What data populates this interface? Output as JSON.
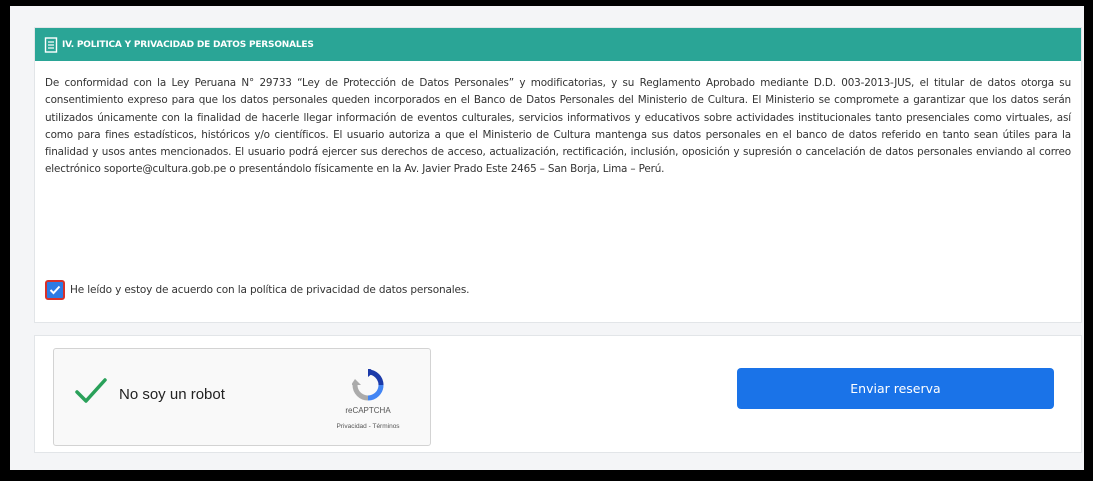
{
  "privacy": {
    "header_icon": "document-icon",
    "title": "IV. POLITICA Y PRIVACIDAD DE DATOS PERSONALES",
    "policy_text": "De conformidad con la Ley Peruana N° 29733 “Ley de Protección de Datos Personales” y modificatorias, y su Reglamento Aprobado mediante D.D. 003-2013-JUS, el titular de datos otorga su consentimiento expreso para que los datos personales queden incorporados en el Banco de Datos Personales del Ministerio de Cultura. El Ministerio se compromete a garantizar que los datos serán utilizados únicamente con la finalidad de hacerle llegar información de eventos culturales, servicios informativos y educativos sobre actividades institucionales tanto presenciales como virtuales, así como para fines estadísticos, históricos y/o científicos. El usuario autoriza a que el Ministerio de Cultura mantenga sus datos personales en el banco de datos referido en tanto sean útiles para la finalidad y usos antes mencionados. El usuario podrá ejercer sus derechos de acceso, actualización, rectificación, inclusión, oposición y supresión o cancelación de datos personales enviando al correo electrónico soporte@cultura.gob.pe o presentándolo físicamente en la Av. Javier Prado Este 2465 – San Borja, Lima – Perú.",
    "consent_label": "He leído y estoy de acuerdo con la política de privacidad de datos personales.",
    "consent_checked": true
  },
  "recaptcha": {
    "label": "No soy un robot",
    "brand": "reCAPTCHA",
    "privacy_link": "Privacidad",
    "separator": " - ",
    "terms_link": "Términos",
    "checked": true
  },
  "actions": {
    "submit_label": "Enviar reserva"
  },
  "colors": {
    "header_bg": "#2aa596",
    "button_bg": "#1a73e8",
    "checkbox_bg": "#2d7be5",
    "checkbox_border": "#d9312a",
    "recaptcha_check": "#2aa15a"
  }
}
